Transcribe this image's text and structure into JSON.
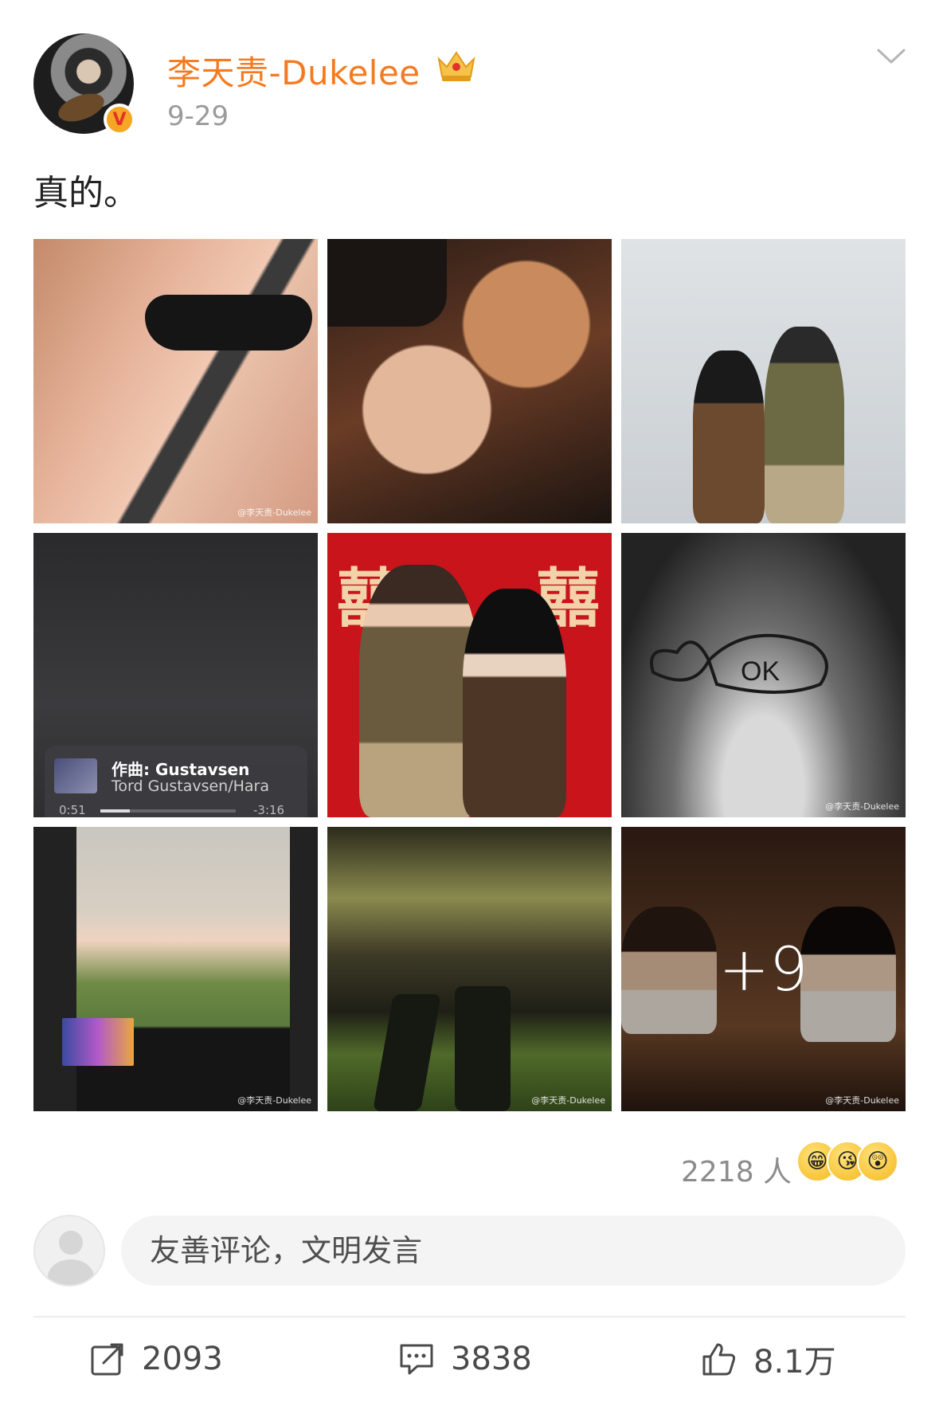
{
  "post": {
    "username": "李天责-Dukelee",
    "timestamp": "9-29",
    "text": "真的。",
    "badge": "V",
    "more_menu_icon": "chevron-down-icon",
    "crown_icon": "crown-icon"
  },
  "photos": {
    "count_visible": 9,
    "more_label": "+9",
    "watermark": "@李天责-Dukelee",
    "music_card": {
      "title": "作曲: Gustavsen",
      "artist": "Tord Gustavsen/Hara",
      "elapsed": "0:51",
      "remaining": "-3:16",
      "progress": 0.22
    }
  },
  "reactions": {
    "count_label": "2218 人",
    "emojis": [
      "grin-icon",
      "kiss-icon",
      "surprised-icon"
    ]
  },
  "comment_bar": {
    "placeholder": "友善评论，文明发言"
  },
  "actions": {
    "share_count": "2093",
    "comment_count": "3838",
    "like_count": "8.1万"
  },
  "colors": {
    "username": "#f57a1f",
    "timestamp": "#9a9a9a",
    "badge": "#f5a623"
  }
}
